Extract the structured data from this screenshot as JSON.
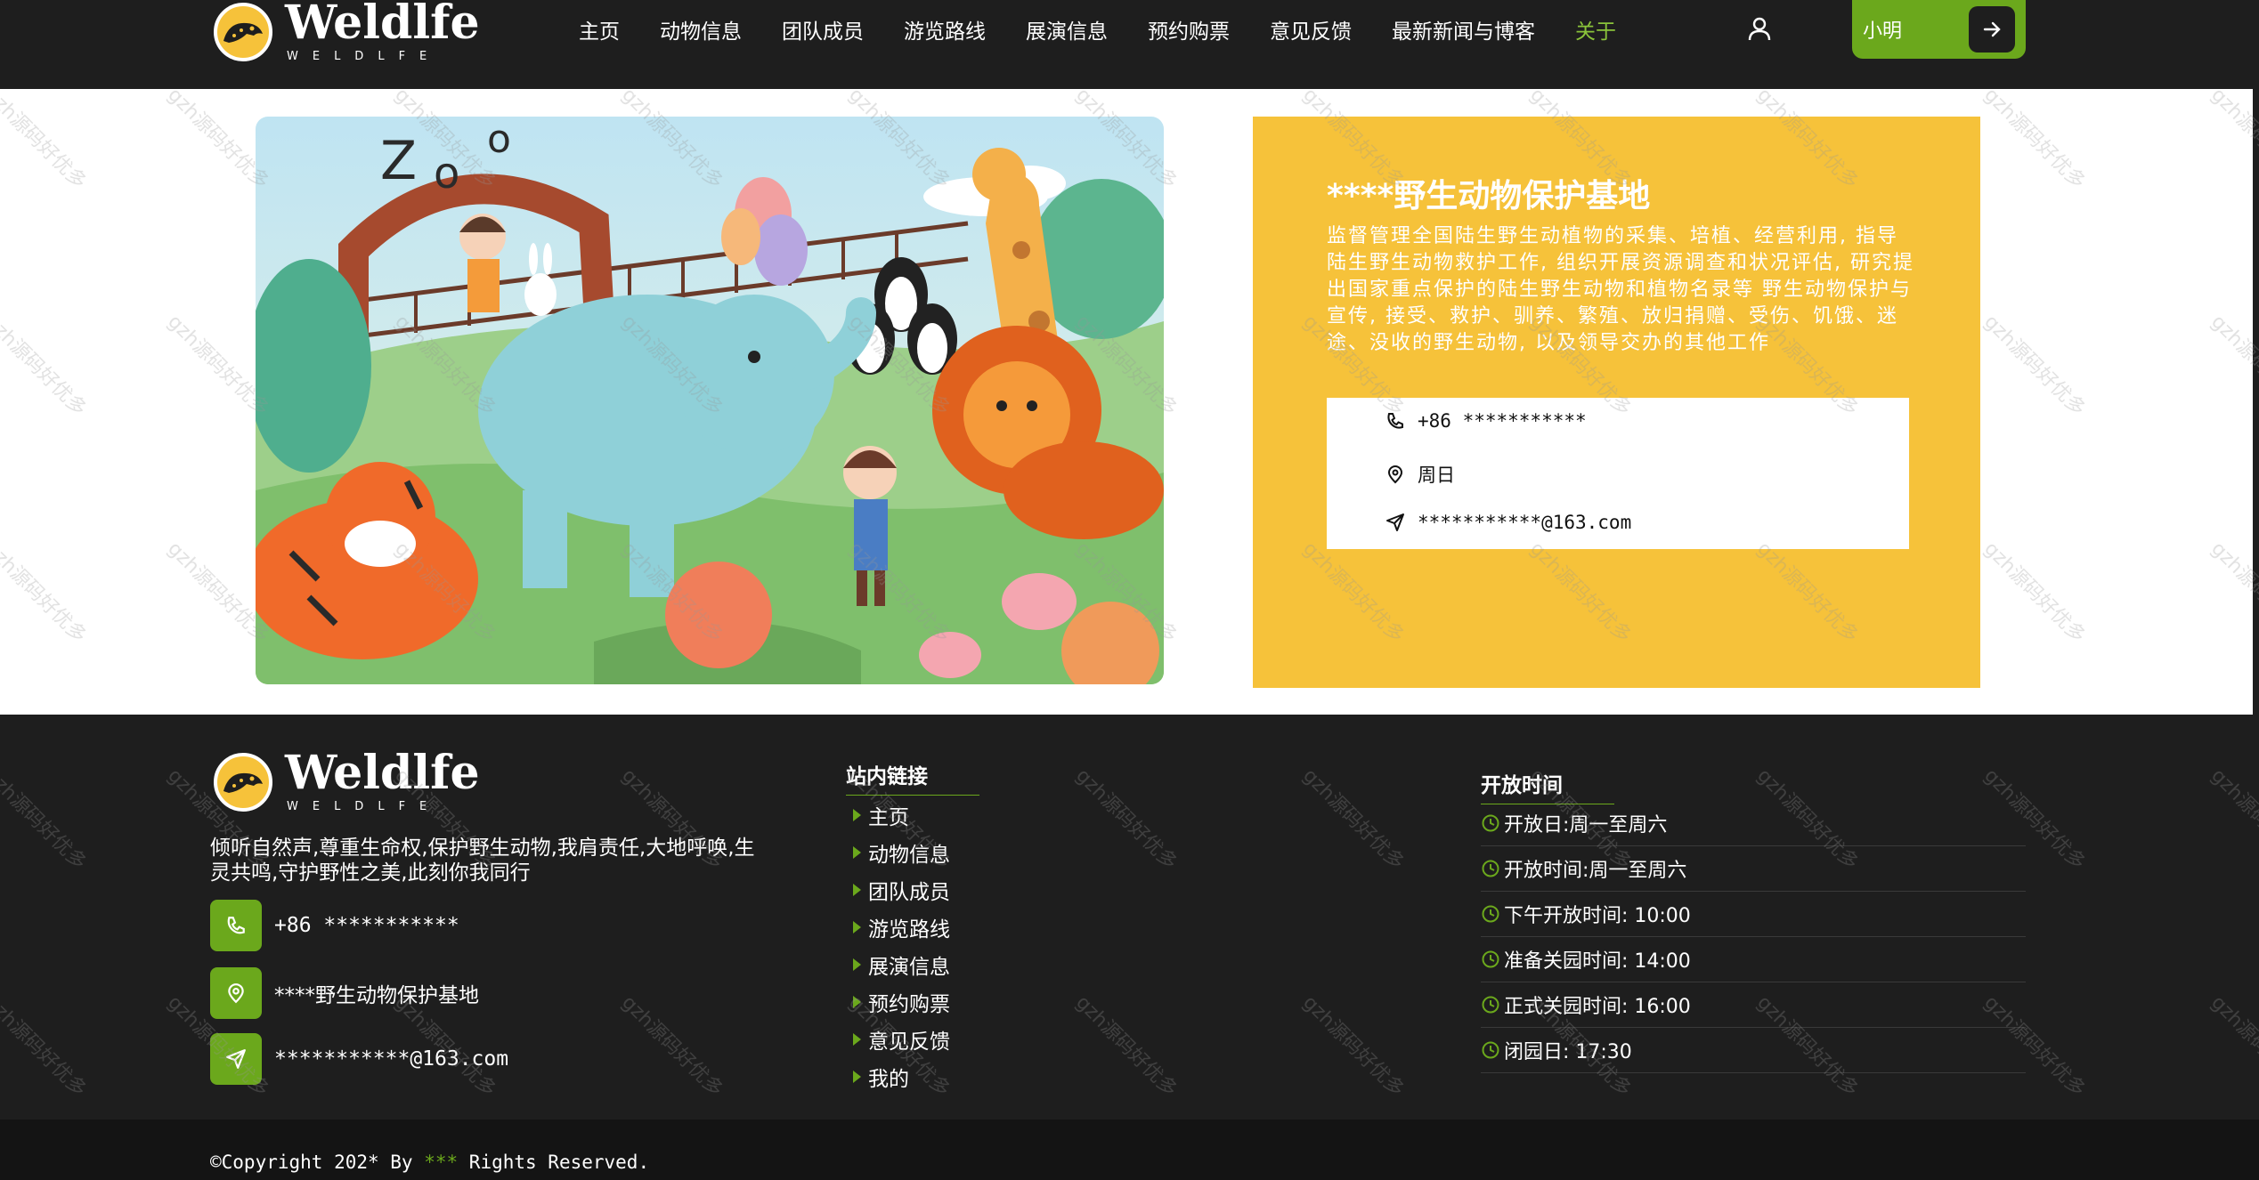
{
  "brand": {
    "name": "Weldlfe",
    "tagline": "WELDLFE"
  },
  "nav": {
    "items": [
      "主页",
      "动物信息",
      "团队成员",
      "游览路线",
      "展演信息",
      "预约购票",
      "意见反馈",
      "最新新闻与博客",
      "关于"
    ],
    "active": "关于"
  },
  "user": {
    "name": "小明"
  },
  "info": {
    "title": "****野生动物保护基地",
    "description": "监督管理全国陆生野生动植物的采集、培植、经营利用, 指导陆生野生动物救护工作, 组织开展资源调查和状况评估, 研究提出国家重点保护的陆生野生动物和植物名录等 野生动物保护与宣传, 接受、救护、驯养、繁殖、放归捐赠、受伤、饥饿、迷途、没收的野生动物, 以及领导交办的其他工作",
    "phone": "+86 ***********",
    "location": "周日",
    "email": "***********@163.com"
  },
  "footer": {
    "about": "倾听自然声,尊重生命权,保护野生动物,我肩责任,大地呼唤,生灵共鸣,守护野性之美,此刻你我同行",
    "phone": "+86 ***********",
    "address": "****野生动物保护基地",
    "email": "***********@163.com",
    "links_title": "站内链接",
    "links": [
      "主页",
      "动物信息",
      "团队成员",
      "游览路线",
      "展演信息",
      "预约购票",
      "意见反馈",
      "我的"
    ],
    "hours_title": "开放时间",
    "hours": [
      "开放日:周一至周六",
      "开放时间:周一至周六",
      "下午开放时间: 10:00",
      "准备关园时间: 14:00",
      "正式关园时间: 16:00",
      "闭园日: 17:30"
    ],
    "copyright_prefix": "©Copyright 202* By ",
    "copyright_highlight": "***",
    "copyright_suffix": " Rights Reserved."
  },
  "watermark": "gzh源码好优多",
  "colors": {
    "dark": "#1e1e1e",
    "accent_green": "#6ba81c",
    "nav_active": "#8ac33a",
    "card_yellow": "#f6c23a"
  },
  "icons": [
    "user-icon",
    "arrow-right-icon",
    "phone-icon",
    "location-pin-icon",
    "send-icon",
    "clock-icon",
    "triangle-bullet-icon",
    "leopard-logo-icon"
  ]
}
